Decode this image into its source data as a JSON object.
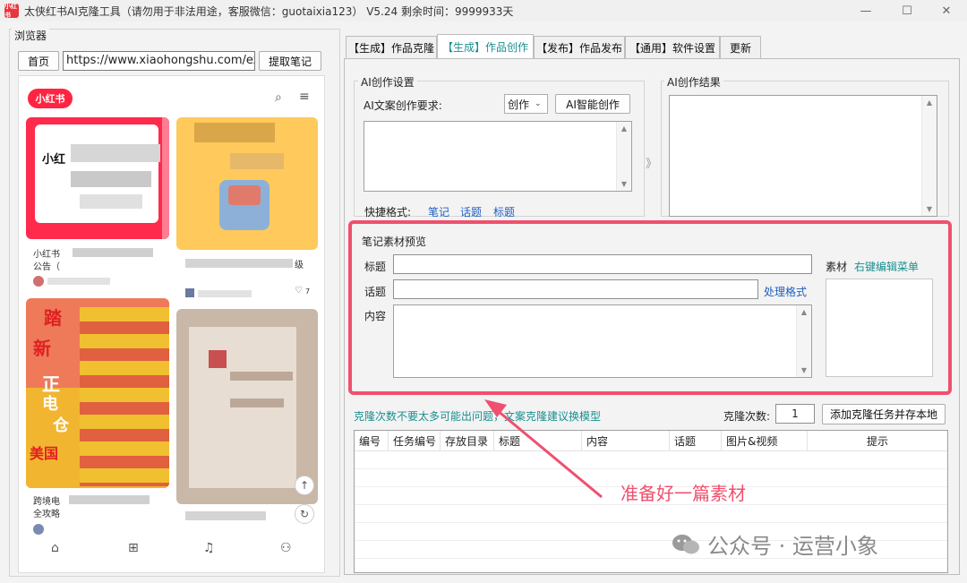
{
  "window": {
    "title": "太侠红书AI克隆工具（请勿用于非法用途，客服微信：guotaixia123） V5.24 剩余时间：9999933天",
    "app_icon_text": "小红书",
    "minimize": "—",
    "maximize": "☐",
    "close": "✕"
  },
  "browser": {
    "group_label": "浏览器",
    "home_button": "首页",
    "url": "https://www.xiaohongshu.com/explore",
    "fetch_button": "提取笔记",
    "phone": {
      "logo": "小红书",
      "card1_overlay": "小红",
      "card1_caption1": "小红书",
      "card1_caption2": "公告（",
      "card2_caption": "级",
      "card2_likes": "7",
      "card3_overlay_lines": [
        "踏",
        "新",
        "正",
        "电",
        "仓",
        "美国"
      ],
      "card3_caption1": "跨境电",
      "card3_caption2": "全攻略"
    }
  },
  "tabs": [
    {
      "label": "【生成】作品克隆",
      "active": false
    },
    {
      "label": "【生成】作品创作",
      "active": true
    },
    {
      "label": "【发布】作品发布",
      "active": false
    },
    {
      "label": "【通用】软件设置",
      "active": false
    },
    {
      "label": "更新",
      "active": false
    }
  ],
  "ai_settings": {
    "group_label": "AI创作设置",
    "requirement_label": "AI文案创作要求:",
    "mode_select": "创作",
    "ai_create_button": "AI智能创作",
    "quick_format_label": "快捷格式:",
    "quick_links": [
      "笔记",
      "话题",
      "标题"
    ]
  },
  "ai_result": {
    "group_label": "AI创作结果",
    "arrow": "》"
  },
  "preview": {
    "group_label": "笔记素材预览",
    "title_label": "标题",
    "topic_label": "话题",
    "format_link": "处理格式",
    "content_label": "内容",
    "material_label": "素材",
    "menu_link": "右键编辑菜单"
  },
  "clone": {
    "hint": "克隆次数不要太多可能出问题，文案克隆建议换模型",
    "count_label": "克隆次数:",
    "count_value": "1",
    "add_button": "添加克隆任务并存本地"
  },
  "table": {
    "columns": [
      "编号",
      "任务编号",
      "存放目录",
      "标题",
      "内容",
      "话题",
      "图片&视频",
      "提示"
    ]
  },
  "annotation": {
    "text": "准备好一篇素材",
    "color": "#f0506e"
  },
  "watermark": {
    "text": "公众号 · 运营小象"
  },
  "colors": {
    "accent_teal": "#1a8f8f",
    "link_blue": "#1f5fbf",
    "xhs_red": "#ff2442",
    "highlight_pink": "#f0506e"
  }
}
